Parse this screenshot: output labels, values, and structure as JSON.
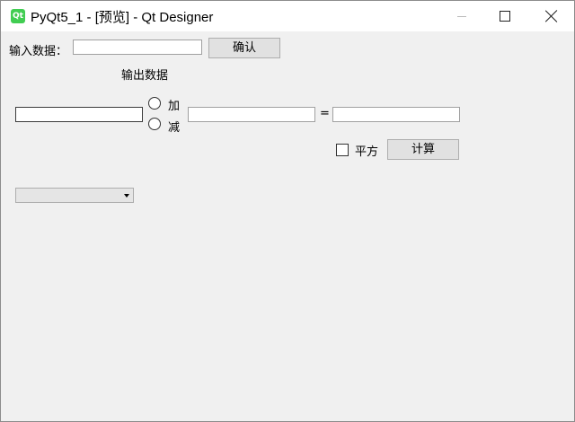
{
  "window": {
    "title": "PyQt5_1 - [预览] - Qt Designer",
    "app_icon_text": "Qt"
  },
  "form": {
    "input_label": "输入数据：",
    "input_value": "",
    "confirm_label": "确认",
    "output_label": "输出数据",
    "operand1_value": "",
    "radio_add_label": "加",
    "radio_sub_label": "减",
    "operand2_value": "",
    "equals_label": "=",
    "result_value": "",
    "square_label": "平方",
    "compute_label": "计算",
    "combo_selected": ""
  },
  "colors": {
    "window_bg": "#f0f0f0",
    "titlebar_bg": "#ffffff",
    "qt_green": "#41cd52"
  }
}
